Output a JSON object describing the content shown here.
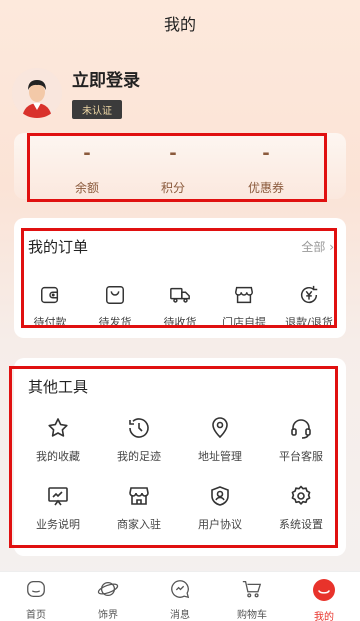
{
  "header": {
    "title": "我的"
  },
  "profile": {
    "login_label": "立即登录",
    "status_badge": "未认证"
  },
  "stats": [
    {
      "value": "-",
      "label": "余额"
    },
    {
      "value": "-",
      "label": "积分"
    },
    {
      "value": "-",
      "label": "优惠券"
    }
  ],
  "orders": {
    "title": "我的订单",
    "more_label": "全部 ›",
    "items": [
      {
        "label": "待付款",
        "icon": "wallet-icon"
      },
      {
        "label": "待发货",
        "icon": "bag-icon"
      },
      {
        "label": "待收货",
        "icon": "truck-icon"
      },
      {
        "label": "门店自提",
        "icon": "store-icon"
      },
      {
        "label": "退款/退货",
        "icon": "refund-icon"
      }
    ]
  },
  "tools": {
    "title": "其他工具",
    "items": [
      {
        "label": "我的收藏",
        "icon": "star-icon"
      },
      {
        "label": "我的足迹",
        "icon": "history-icon"
      },
      {
        "label": "地址管理",
        "icon": "location-icon"
      },
      {
        "label": "平台客服",
        "icon": "headset-icon"
      },
      {
        "label": "业务说明",
        "icon": "chart-board-icon"
      },
      {
        "label": "商家入驻",
        "icon": "shop-icon"
      },
      {
        "label": "用户协议",
        "icon": "shield-user-icon"
      },
      {
        "label": "系统设置",
        "icon": "gear-icon"
      }
    ]
  },
  "tabbar": {
    "items": [
      {
        "label": "首页",
        "icon": "home-icon"
      },
      {
        "label": "饰界",
        "icon": "planet-icon"
      },
      {
        "label": "消息",
        "icon": "message-icon"
      },
      {
        "label": "购物车",
        "icon": "cart-icon"
      },
      {
        "label": "我的",
        "icon": "user-icon"
      }
    ],
    "active_color": "#e8332b"
  }
}
